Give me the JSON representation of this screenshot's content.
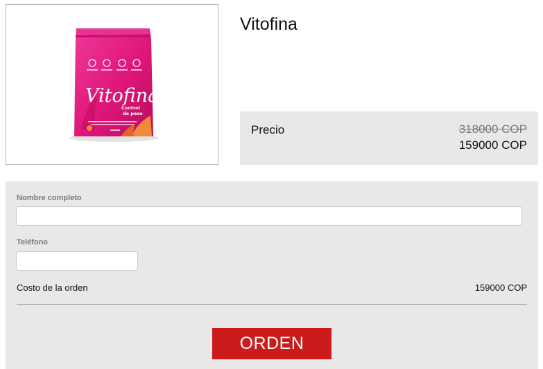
{
  "product": {
    "title": "Vitofina",
    "image": {
      "brand_text": "Vitofina",
      "sub_text": "Control de peso",
      "colors": {
        "pouch": "#e0157a",
        "pouch_dark": "#b80f63",
        "accent": "#f08a3a"
      }
    }
  },
  "price": {
    "label": "Precio",
    "old": "318000 COP",
    "new": "159000 COP"
  },
  "form": {
    "name_label": "Nombre completo",
    "name_value": "",
    "phone_label": "Teléfono",
    "phone_value": "",
    "cost_label": "Costo de la orden",
    "cost_value": "159000 COP",
    "submit_label": "ORDEN"
  },
  "colors": {
    "panel_bg": "#e8e8e8",
    "button_bg": "#cc1b1b",
    "button_text": "#ffffff"
  }
}
